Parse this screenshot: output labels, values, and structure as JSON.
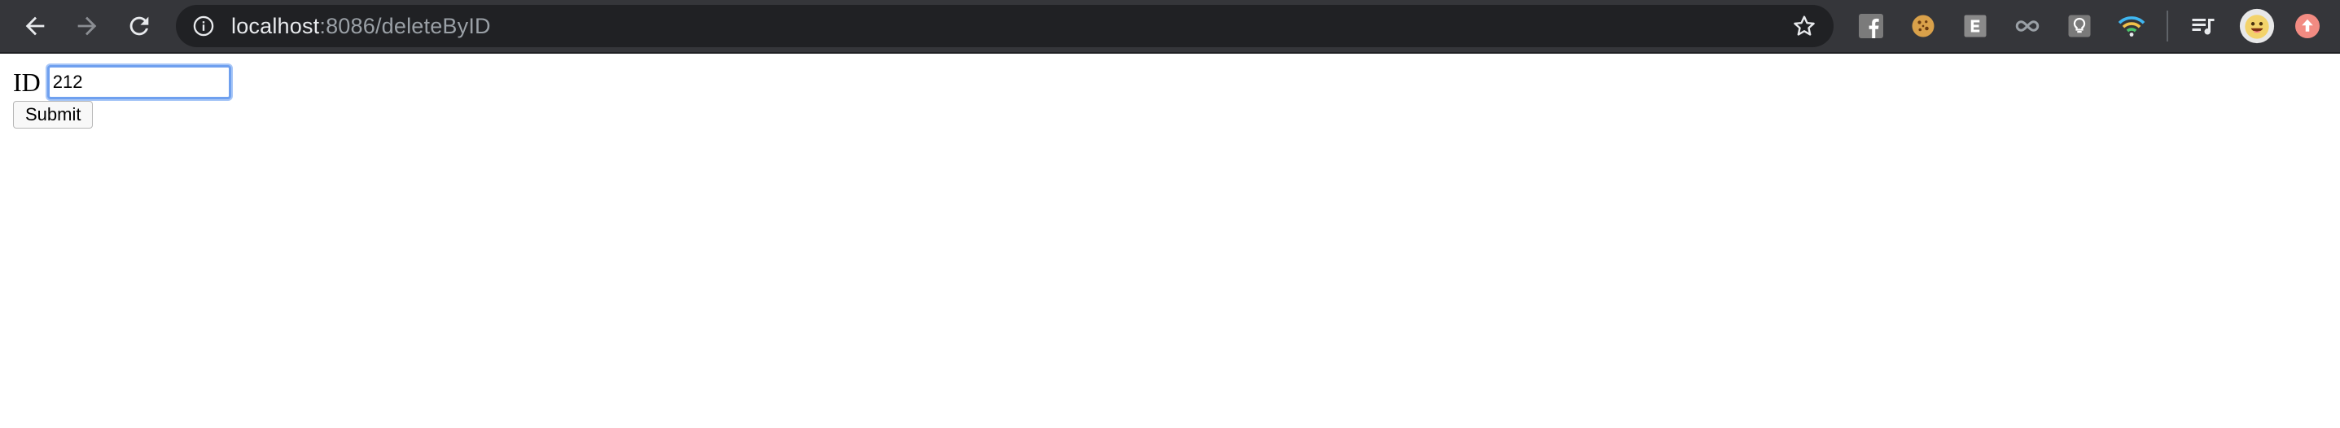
{
  "browser": {
    "url_host": "localhost",
    "url_rest": ":8086/deleteByID",
    "icons": {
      "back": "back-arrow-icon",
      "forward": "forward-arrow-icon",
      "reload": "reload-icon",
      "site_info": "info-icon",
      "bookmark": "star-icon"
    },
    "extensions": [
      {
        "name": "facebook-extension-icon",
        "letter": "f",
        "color": "#7b7b7b"
      },
      {
        "name": "cookie-extension-icon",
        "color": "#d9a14a"
      },
      {
        "name": "e-extension-icon",
        "letter": "E",
        "color": "#8a8a8a"
      },
      {
        "name": "infinity-extension-icon",
        "color": "#9aa0a6"
      },
      {
        "name": "lightbulb-extension-icon",
        "color": "#8a8a8a"
      },
      {
        "name": "wifi-extension-icon",
        "color": "#3fb6f0"
      },
      {
        "name": "playlist-icon",
        "color": "#e8eaed"
      },
      {
        "name": "profile-avatar-icon",
        "color": "#f3d36b"
      },
      {
        "name": "update-icon",
        "color": "#f28b82"
      }
    ]
  },
  "form": {
    "label": "ID",
    "input_value": "212",
    "submit_label": "Submit"
  },
  "colors": {
    "toolbar_bg": "#35363a",
    "omnibox_bg": "#202124",
    "focus_ring": "#6fa0ef"
  }
}
